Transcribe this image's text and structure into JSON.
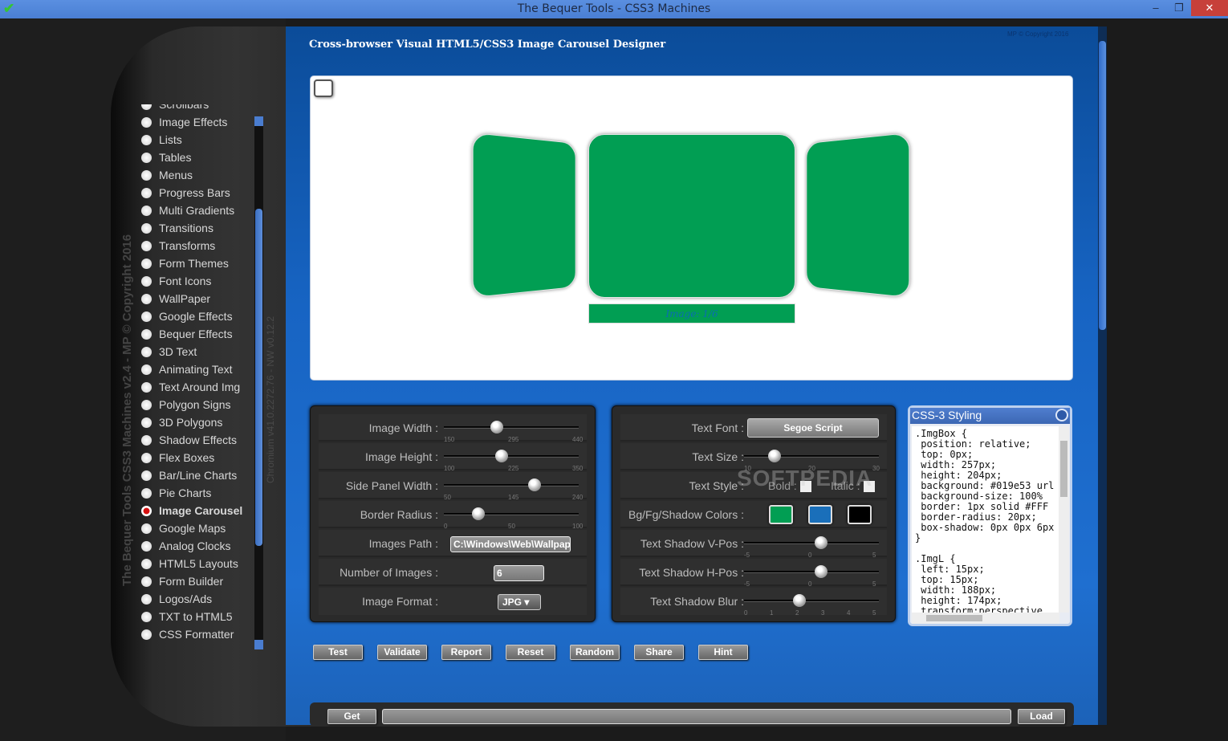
{
  "window": {
    "title": "The Bequer Tools - CSS3 Machines",
    "min_label": "–",
    "restore_label": "❐",
    "close_label": "✕"
  },
  "sidebar": {
    "vertical_title": "The Bequer Tools CSS3 Machines v2.4 - MP © Copyright 2016",
    "vertical_subtitle": "Chromium v41.0.2272.76 - NW v0.12.2",
    "items": [
      {
        "label": "Scrollbars"
      },
      {
        "label": "Image Effects"
      },
      {
        "label": "Lists"
      },
      {
        "label": "Tables"
      },
      {
        "label": "Menus"
      },
      {
        "label": "Progress Bars"
      },
      {
        "label": "Multi Gradients"
      },
      {
        "label": "Transitions"
      },
      {
        "label": "Transforms"
      },
      {
        "label": "Form Themes"
      },
      {
        "label": "Font Icons"
      },
      {
        "label": "WallPaper"
      },
      {
        "label": "Google Effects"
      },
      {
        "label": "Bequer Effects"
      },
      {
        "label": "3D Text"
      },
      {
        "label": "Animating Text"
      },
      {
        "label": "Text Around Img"
      },
      {
        "label": "Polygon Signs"
      },
      {
        "label": "3D Polygons"
      },
      {
        "label": "Shadow Effects"
      },
      {
        "label": "Flex Boxes"
      },
      {
        "label": "Bar/Line Charts"
      },
      {
        "label": "Pie Charts"
      },
      {
        "label": "Image Carousel",
        "active": true
      },
      {
        "label": "Google Maps"
      },
      {
        "label": "Analog Clocks"
      },
      {
        "label": "HTML5 Layouts"
      },
      {
        "label": "Form Builder"
      },
      {
        "label": "Logos/Ads"
      },
      {
        "label": "TXT to HTML5"
      },
      {
        "label": "CSS Formatter"
      }
    ]
  },
  "main": {
    "heading": "Cross-browser Visual HTML5/CSS3 Image Carousel Designer",
    "copyright": "MP © Copyright 2016",
    "preview_caption": "Image: 1/6",
    "watermark": "SOFTPEDIA"
  },
  "panel_left": {
    "image_width": {
      "label": "Image Width :",
      "ticks": [
        "150",
        "295",
        "440"
      ],
      "value_pct": 0.38
    },
    "image_height": {
      "label": "Image Height :",
      "ticks": [
        "100",
        "225",
        "350"
      ],
      "value_pct": 0.42
    },
    "side_panel_width": {
      "label": "Side Panel Width :",
      "ticks": [
        "50",
        "145",
        "240"
      ],
      "value_pct": 0.69
    },
    "border_radius": {
      "label": "Border Radius :",
      "ticks": [
        "0",
        "50",
        "100"
      ],
      "value_pct": 0.23
    },
    "images_path": {
      "label": "Images Path :",
      "value": "C:\\Windows\\Web\\Wallpaper"
    },
    "number_of_images": {
      "label": "Number of Images :",
      "value": "6"
    },
    "image_format": {
      "label": "Image Format :",
      "value": "JPG ▾"
    }
  },
  "panel_mid": {
    "text_font": {
      "label": "Text Font :",
      "value": "Segoe Script"
    },
    "text_size": {
      "label": "Text Size :",
      "ticks": [
        "10",
        "20",
        "30"
      ],
      "value_pct": 0.2
    },
    "text_style": {
      "label": "Text Style :",
      "bold": "Bold :",
      "italic": "Italic :"
    },
    "colors": {
      "label": "Bg/Fg/Shadow Colors :",
      "bg": "#019e53",
      "fg": "#1a6fba",
      "shadow": "#000000"
    },
    "text_shadow_vpos": {
      "label": "Text Shadow V-Pos :",
      "ticks": [
        "-5",
        "0",
        "5"
      ],
      "value_pct": 0.58
    },
    "text_shadow_hpos": {
      "label": "Text Shadow H-Pos :",
      "ticks": [
        "-5",
        "0",
        "5"
      ],
      "value_pct": 0.58
    },
    "text_shadow_blur": {
      "label": "Text Shadow Blur :",
      "ticks": [
        "0",
        "1",
        "2",
        "3",
        "4",
        "5"
      ],
      "value_pct": 0.4
    }
  },
  "css_panel": {
    "title": "CSS-3 Styling",
    "code": ".ImgBox {\n position: relative;\n top: 0px;\n width: 257px;\n height: 204px;\n background: #019e53 url\n background-size: 100%\n border: 1px solid #FFF\n border-radius: 20px;\n box-shadow: 0px 0px 6px\n}\n\n.ImgL {\n left: 15px;\n top: 15px;\n width: 188px;\n height: 174px;\n transform:perspective"
  },
  "actions": {
    "test": "Test",
    "validate": "Validate",
    "report": "Report",
    "reset": "Reset",
    "random": "Random",
    "share": "Share",
    "hint": "Hint"
  },
  "bottom": {
    "get": "Get",
    "load": "Load",
    "url": ""
  }
}
